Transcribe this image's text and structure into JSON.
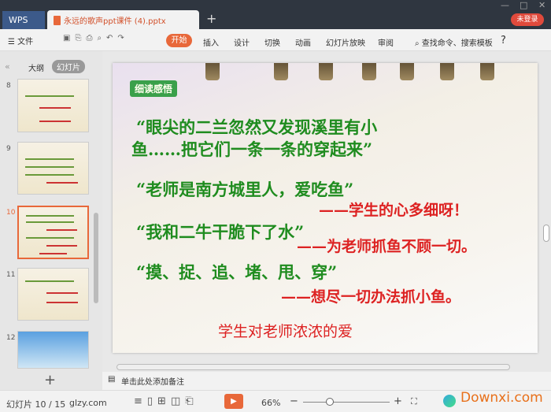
{
  "titlebar": {
    "app": "WPS",
    "doc_tab": "永远的歌声ppt课件 (4).pptx",
    "new_tab": "+",
    "login": "未登录"
  },
  "toolbar": {
    "menu": "☰ 文件",
    "tabs": [
      "开始",
      "插入",
      "设计",
      "切换",
      "动画",
      "幻灯片放映",
      "审阅"
    ],
    "search": "查找命令、搜索模板",
    "help": "?"
  },
  "left_panel": {
    "tabs": [
      "大纲",
      "幻灯片"
    ],
    "slides": [
      8,
      9,
      10,
      11,
      12
    ],
    "selected": 10,
    "add": "+"
  },
  "slide": {
    "badge": "细读感悟",
    "lines": [
      {
        "text": "“眼尖的二兰忽然又发现溪里有小",
        "color": "green"
      },
      {
        "text": "鱼……把它们一条一条的穿起来”",
        "color": "green"
      },
      {
        "text": "“老师是南方城里人，爱吃鱼”",
        "color": "green"
      },
      {
        "text": "——学生的心多细呀！",
        "color": "red"
      },
      {
        "text": "“我和二牛干脆下了水”",
        "color": "green"
      },
      {
        "text": "——为老师抓鱼不顾一切。",
        "color": "red"
      },
      {
        "text": "“摸、捉、追、堵、甩、穿”",
        "color": "green"
      },
      {
        "text": "——想尽一切办法抓小鱼。",
        "color": "red"
      },
      {
        "text": "学生对老师浓浓的爱",
        "color": "red"
      }
    ]
  },
  "notes": {
    "placeholder": "单击此处添加备注"
  },
  "status": {
    "slide_count": "幻灯片 10 / 15",
    "site": "glzy.com",
    "zoom": "66%",
    "watermark": "Downxi.com"
  },
  "colors": {
    "accent": "#e8683a",
    "green": "#1f8c1f",
    "red": "#d22222"
  }
}
